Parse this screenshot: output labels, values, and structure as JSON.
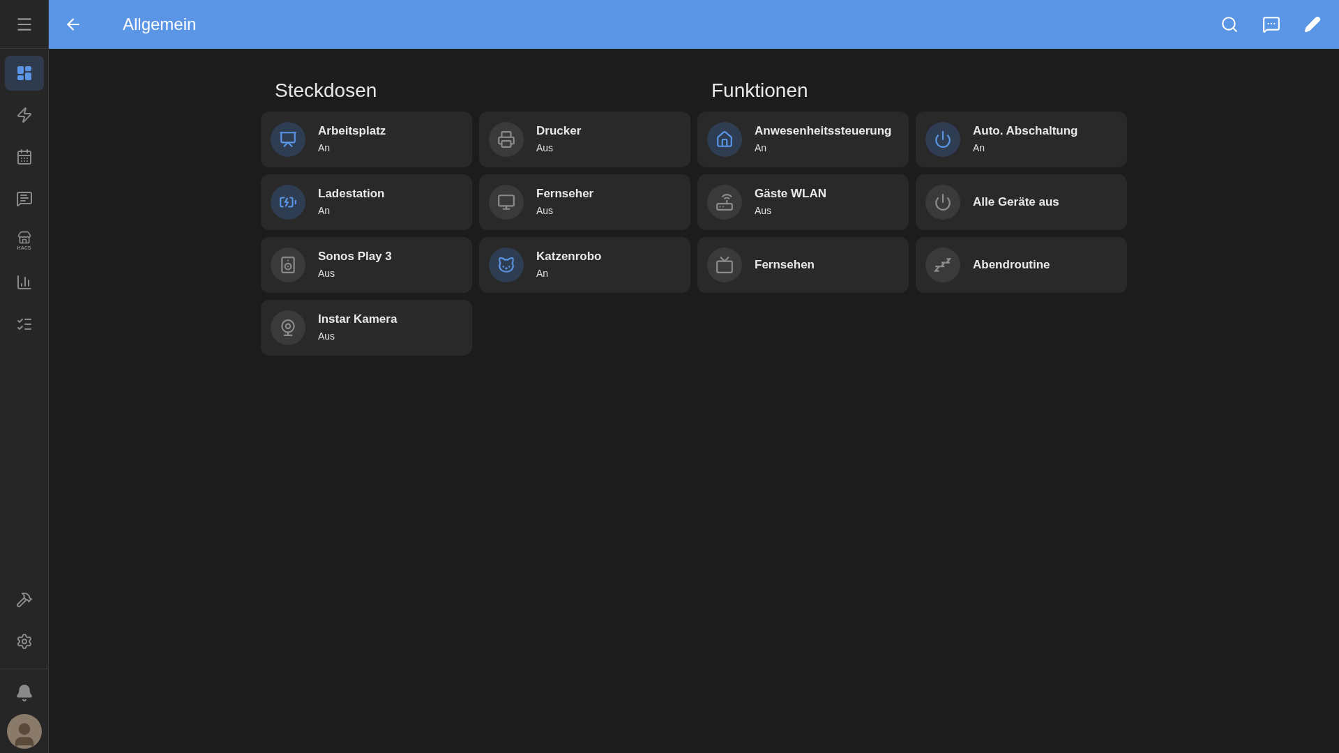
{
  "header": {
    "title": "Allgemein"
  },
  "sidebar": {
    "items": [
      {
        "selected": true
      },
      {
        "selected": false
      },
      {
        "selected": false
      },
      {
        "selected": false
      },
      {
        "selected": false,
        "label": "HACS"
      },
      {
        "selected": false
      },
      {
        "selected": false
      }
    ],
    "bottom_items": [
      {
        "selected": false
      },
      {
        "selected": false
      }
    ]
  },
  "sections": [
    {
      "title": "Steckdosen",
      "tiles": [
        {
          "kind": "switch",
          "name": "Arbeitsplatz",
          "state": "An",
          "on": true
        },
        {
          "kind": "switch",
          "name": "Drucker",
          "state": "Aus",
          "on": false
        },
        {
          "kind": "switch",
          "name": "Ladestation",
          "state": "An",
          "on": true
        },
        {
          "kind": "switch",
          "name": "Fernseher",
          "state": "Aus",
          "on": false
        },
        {
          "kind": "switch",
          "name": "Sonos Play 3",
          "state": "Aus",
          "on": false
        },
        {
          "kind": "switch",
          "name": "Katzenrobo",
          "state": "An",
          "on": true
        },
        {
          "kind": "switch",
          "name": "Instar Kamera",
          "state": "Aus",
          "on": false
        }
      ]
    },
    {
      "title": "Funktionen",
      "tiles": [
        {
          "kind": "switch",
          "name": "Anwesenheitssteuerung",
          "state": "An",
          "on": true
        },
        {
          "kind": "switch",
          "name": "Auto. Abschaltung",
          "state": "An",
          "on": true
        },
        {
          "kind": "switch",
          "name": "Gäste WLAN",
          "state": "Aus",
          "on": false
        },
        {
          "kind": "script",
          "name": "Alle Geräte aus"
        },
        {
          "kind": "script",
          "name": "Fernsehen"
        },
        {
          "kind": "script",
          "name": "Abendroutine"
        }
      ]
    }
  ]
}
